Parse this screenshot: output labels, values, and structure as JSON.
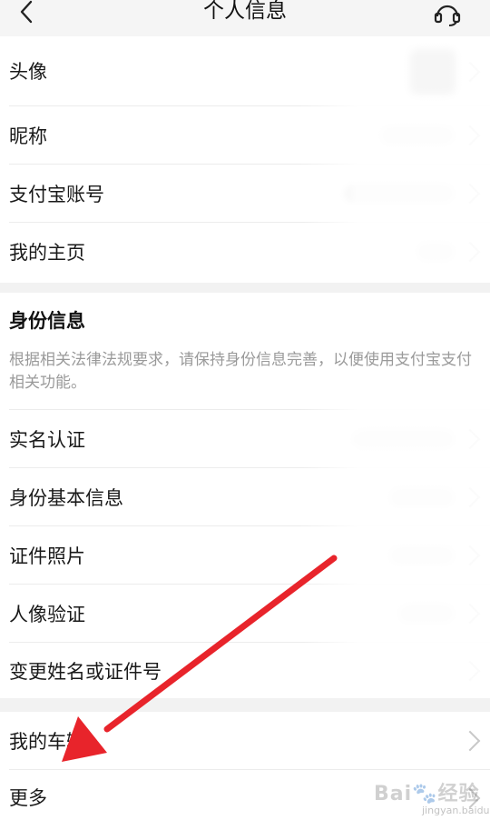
{
  "header": {
    "title": "个人信息",
    "back_icon": "chevron-left-icon",
    "service_icon": "headset-icon"
  },
  "profile": {
    "items": [
      {
        "label": "头像"
      },
      {
        "label": "昵称"
      },
      {
        "label": "支付宝账号"
      },
      {
        "label": "我的主页"
      }
    ]
  },
  "identity": {
    "title": "身份信息",
    "description": "根据相关法律法规要求，请保持身份信息完善，以便使用支付宝支付相关功能。",
    "items": [
      {
        "label": "实名认证"
      },
      {
        "label": "身份基本信息"
      },
      {
        "label": "证件照片"
      },
      {
        "label": "人像验证"
      },
      {
        "label": "变更姓名或证件号"
      }
    ]
  },
  "more_section": {
    "items": [
      {
        "label": "我的车辆"
      },
      {
        "label": "更多"
      }
    ]
  },
  "annotation": {
    "color": "#e8242b"
  },
  "watermark": {
    "text": "Bai🐾经验",
    "sub": "jingyan.baidu.com"
  }
}
